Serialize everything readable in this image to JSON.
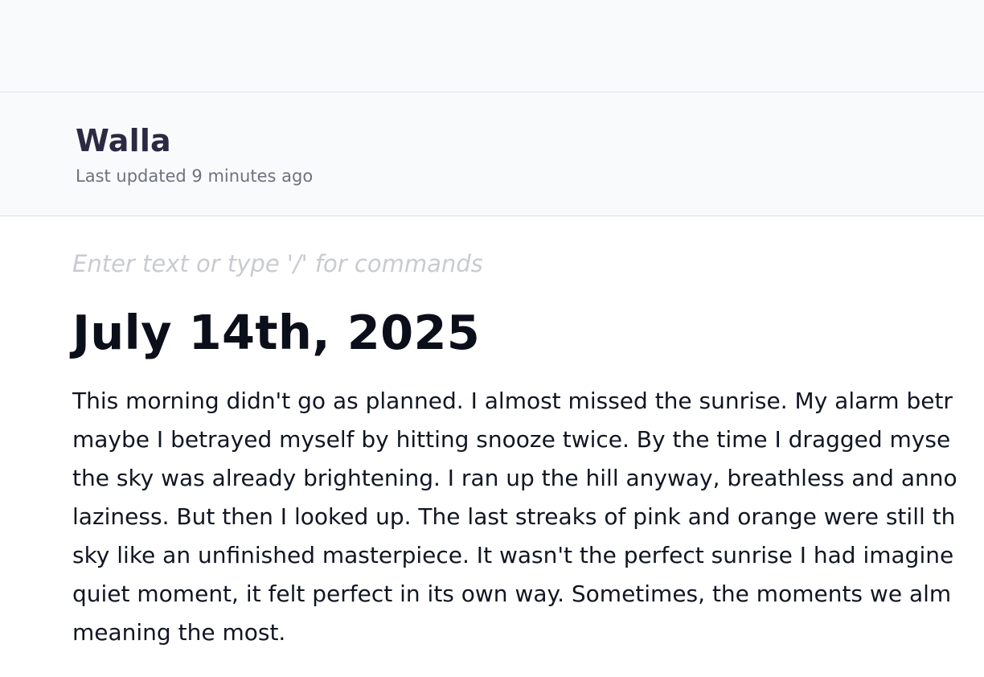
{
  "document": {
    "title": "Walla",
    "last_updated": "Last updated 9 minutes ago"
  },
  "editor": {
    "placeholder": "Enter text or type '/' for commands",
    "heading": "July 14th, 2025",
    "body_lines": [
      "This morning didn't go as planned. I almost missed the sunrise. My alarm betr",
      "maybe I betrayed myself by hitting snooze twice. By the time I dragged myse",
      "the sky was already brightening. I ran up the hill anyway, breathless and anno",
      "laziness. But then I looked up. The last streaks of pink and orange were still th",
      "sky like an unfinished masterpiece. It wasn't the perfect sunrise I had imagine",
      "quiet moment, it felt perfect in its own way. Sometimes, the moments we alm",
      "meaning the most."
    ]
  }
}
